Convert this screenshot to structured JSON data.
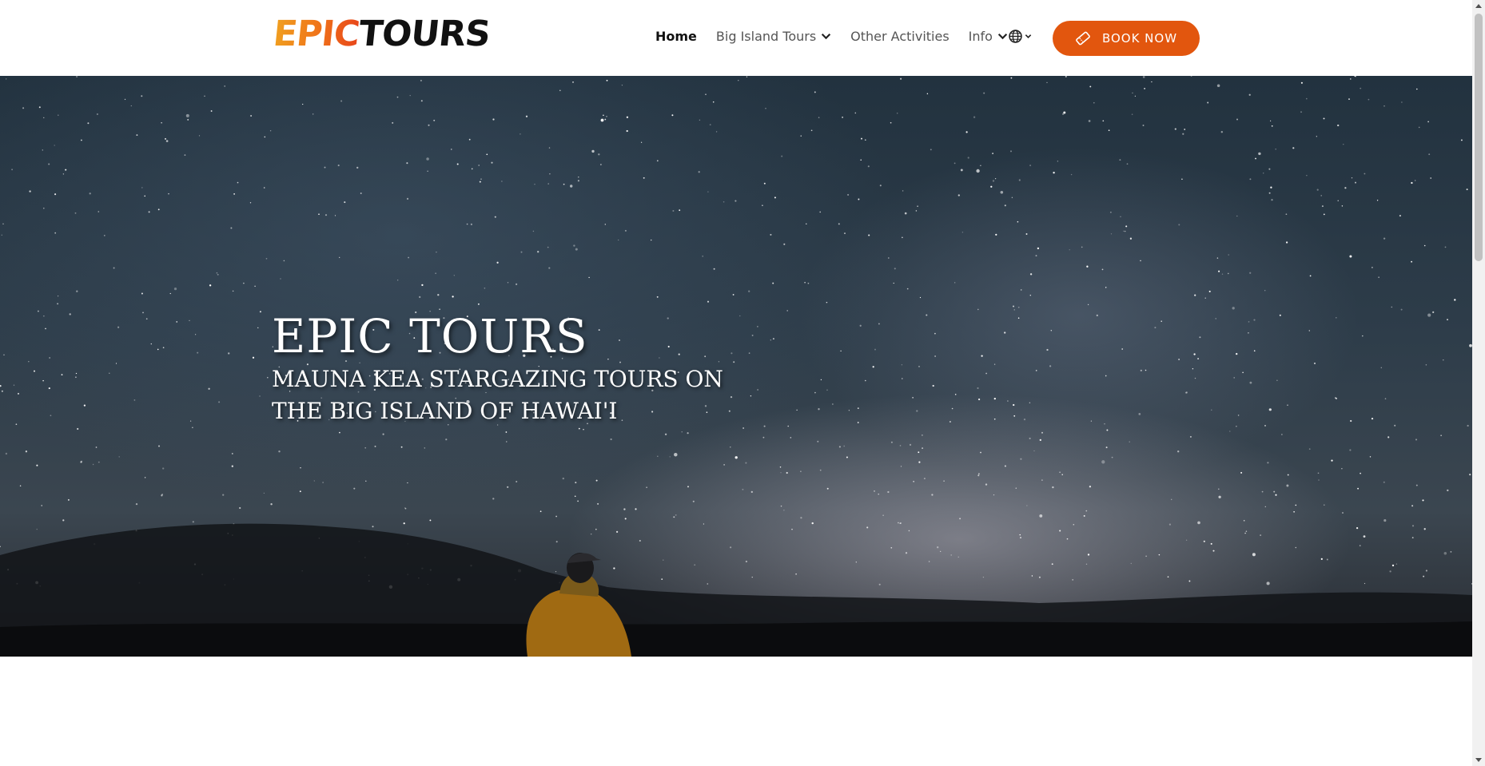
{
  "header": {
    "logo": {
      "part1": "EPIC",
      "part2": "TOURS"
    },
    "nav": [
      {
        "label": "Home",
        "active": true,
        "has_dropdown": false
      },
      {
        "label": "Big Island Tours",
        "active": false,
        "has_dropdown": true
      },
      {
        "label": "Other Activities",
        "active": false,
        "has_dropdown": false
      },
      {
        "label": "Info",
        "active": false,
        "has_dropdown": true
      }
    ],
    "language_icon": "globe-icon",
    "book_button": {
      "label": "BOOK NOW",
      "icon": "ticket-icon"
    }
  },
  "hero": {
    "title": "EPIC TOURS",
    "subtitle": "MAUNA KEA STARGAZING TOURS ON THE BIG ISLAND OF HAWAI'I"
  },
  "colors": {
    "accent": "#e2560e",
    "nav_text": "#555555",
    "nav_active": "#111111",
    "logo_gradient": [
      "#f0a020",
      "#e8461a"
    ]
  }
}
